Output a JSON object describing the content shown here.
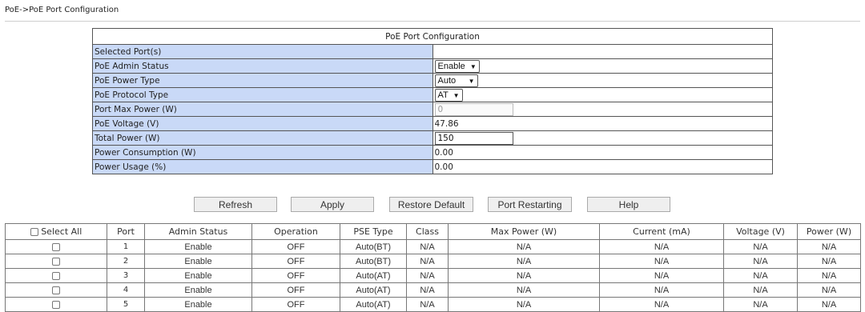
{
  "breadcrumb": "PoE->PoE Port Configuration",
  "config": {
    "title": "PoE Port Configuration",
    "selected_ports": {
      "label": "Selected Port(s)",
      "value": ""
    },
    "admin_status": {
      "label": "PoE Admin Status",
      "value": "Enable"
    },
    "power_type": {
      "label": "PoE Power Type",
      "value": "Auto"
    },
    "protocol_type": {
      "label": "PoE Protocol Type",
      "value": "AT"
    },
    "port_max_power": {
      "label": "Port Max Power (W)",
      "value": "0"
    },
    "voltage": {
      "label": "PoE Voltage (V)",
      "value": "47.86"
    },
    "total_power": {
      "label": "Total Power (W)",
      "value": "150"
    },
    "power_consumption": {
      "label": "Power Consumption (W)",
      "value": "0.00"
    },
    "power_usage": {
      "label": "Power Usage (%)",
      "value": "0.00"
    }
  },
  "buttons": {
    "refresh": "Refresh",
    "apply": "Apply",
    "restore_default": "Restore Default",
    "port_restarting": "Port Restarting",
    "help": "Help"
  },
  "ports_table": {
    "headers": [
      "Select All",
      "Port",
      "Admin Status",
      "Operation",
      "PSE Type",
      "Class",
      "Max Power (W)",
      "Current (mA)",
      "Voltage (V)",
      "Power (W)"
    ],
    "rows": [
      [
        "1",
        "Enable",
        "OFF",
        "Auto(BT)",
        "N/A",
        "N/A",
        "N/A",
        "N/A",
        "N/A"
      ],
      [
        "2",
        "Enable",
        "OFF",
        "Auto(BT)",
        "N/A",
        "N/A",
        "N/A",
        "N/A",
        "N/A"
      ],
      [
        "3",
        "Enable",
        "OFF",
        "Auto(AT)",
        "N/A",
        "N/A",
        "N/A",
        "N/A",
        "N/A"
      ],
      [
        "4",
        "Enable",
        "OFF",
        "Auto(AT)",
        "N/A",
        "N/A",
        "N/A",
        "N/A",
        "N/A"
      ],
      [
        "5",
        "Enable",
        "OFF",
        "Auto(AT)",
        "N/A",
        "N/A",
        "N/A",
        "N/A",
        "N/A"
      ]
    ]
  }
}
